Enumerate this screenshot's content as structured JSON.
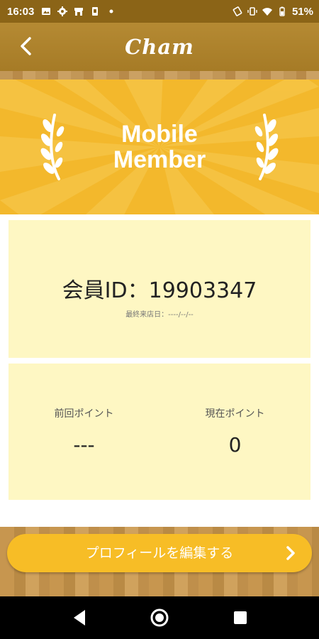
{
  "status_bar": {
    "time": "16:03",
    "battery": "51%",
    "left_icons": [
      "image-icon",
      "settings-icon",
      "store-icon",
      "phone-app-icon",
      "dot-icon"
    ],
    "right_icons": [
      "rotate-icon",
      "vibrate-icon",
      "wifi-icon",
      "battery-icon"
    ]
  },
  "header": {
    "logo": "Cham",
    "back_icon": "back-chevron-icon"
  },
  "banner": {
    "line1": "Mobile",
    "line2": "Member",
    "color": "#f3b82c"
  },
  "member": {
    "id_text": "会員ID：19903347",
    "last_visit": "最終来店日：----/--/--"
  },
  "points": {
    "previous_label": "前回ポイント",
    "previous_value": "---",
    "current_label": "現在ポイント",
    "current_value": "0"
  },
  "actions": {
    "edit_profile": "プロフィールを編集する",
    "button_color": "#f7bd26"
  },
  "nav": {
    "back": "nav-back-icon",
    "home": "nav-home-icon",
    "recents": "nav-recents-icon"
  }
}
